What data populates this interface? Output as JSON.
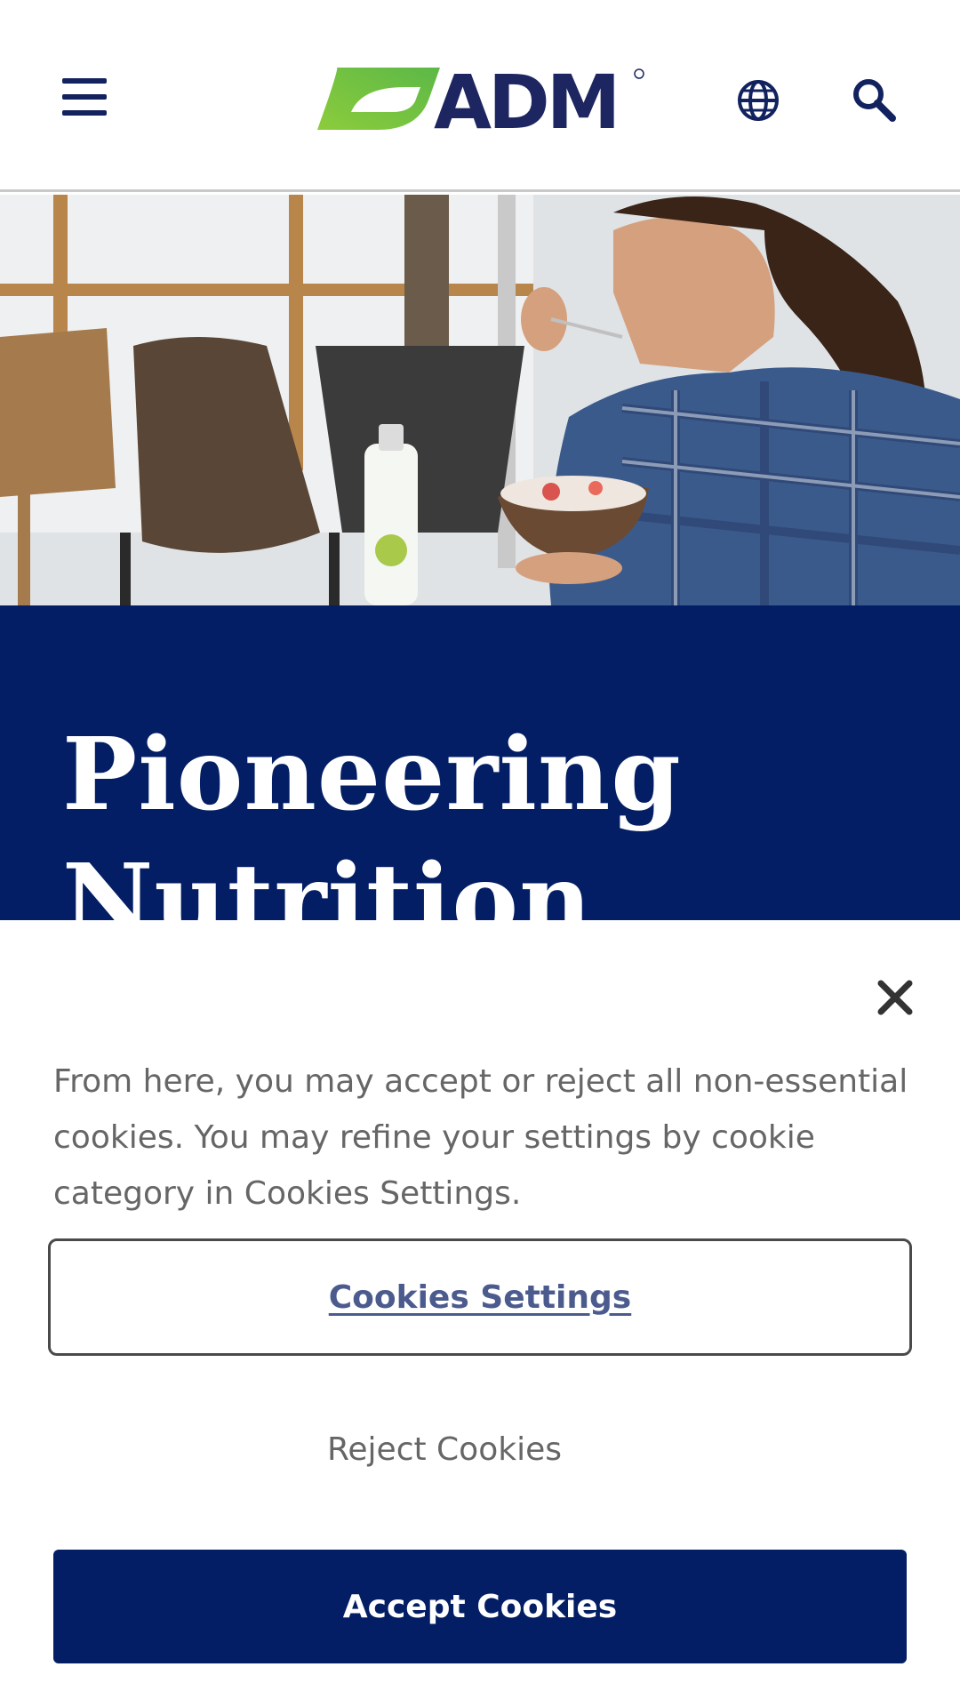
{
  "header": {
    "brand_name": "ADM",
    "menu_icon": "hamburger-menu-icon",
    "language_icon": "globe-icon",
    "search_icon": "search-icon"
  },
  "hero": {
    "image_description_icon": "hero-photo",
    "title": "Pioneering Nutrition"
  },
  "cookie_banner": {
    "message": "From here, you may accept or reject all non-essential cookies. You may refine your settings by cookie category in Cookies Settings.",
    "settings_label": "Cookies Settings",
    "reject_label": "Reject Cookies",
    "accept_label": "Accept Cookies",
    "close_icon": "close-icon"
  },
  "colors": {
    "brand_navy": "#031e64",
    "brand_green": "#6cc24a",
    "text_gray": "#666666",
    "link_blue": "#4c5b8e"
  }
}
